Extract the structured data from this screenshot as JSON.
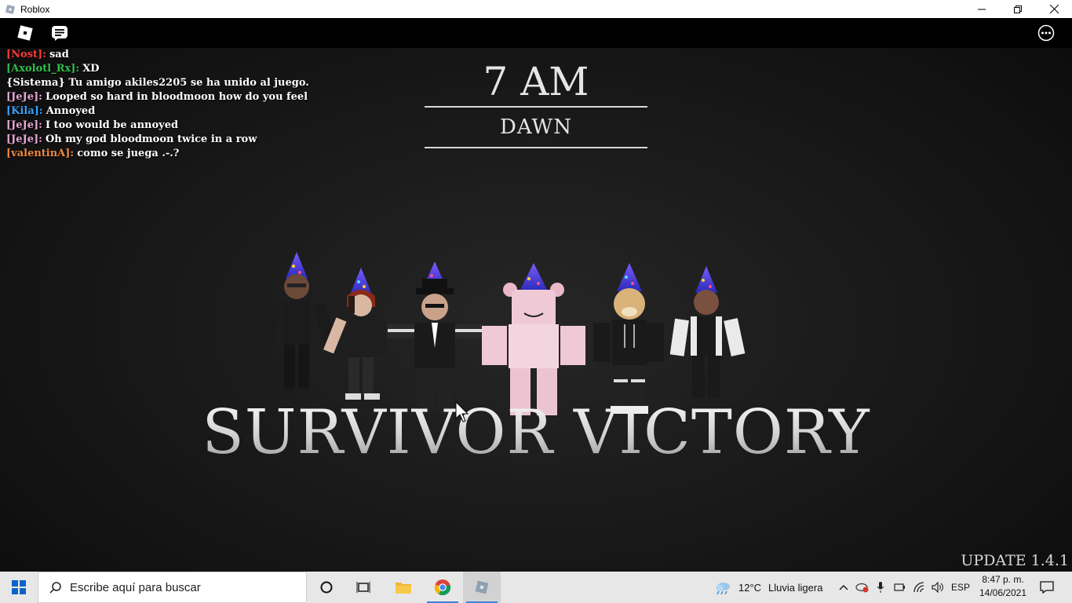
{
  "window": {
    "title": "Roblox"
  },
  "chat": [
    {
      "name": "[Nost]:",
      "color": "#ff3b3b",
      "text": "sad"
    },
    {
      "name": "[Axolotl_Rx]:",
      "color": "#2fbf4a",
      "text": "XD"
    },
    {
      "name": "",
      "color": "#ffffff",
      "text": "{Sistema} Tu amigo akiles2205 se ha unido al juego."
    },
    {
      "name": "[JeJe]:",
      "color": "#e7a6d3",
      "text": "Looped so hard in bloodmoon how do you feel"
    },
    {
      "name": "[Kila]:",
      "color": "#36a3ff",
      "text": "Annoyed"
    },
    {
      "name": "[JeJe]:",
      "color": "#e7a6d3",
      "text": "I too would be annoyed"
    },
    {
      "name": "[JeJe]:",
      "color": "#e7a6d3",
      "text": "Oh my god bloodmoon twice in a row"
    },
    {
      "name": "[valentinA]:",
      "color": "#f0883e",
      "text": "como se juega .-.?"
    }
  ],
  "game": {
    "hour": "7 AM",
    "phase": "DAWN",
    "result": "SURVIVOR VICTORY",
    "version": "UPDATE 1.4.1"
  },
  "taskbar": {
    "search_placeholder": "Escribe aquí para buscar",
    "weather_temp": "12°C",
    "weather_desc": "Lluvia ligera",
    "language": "ESP",
    "time": "8:47 p. m.",
    "date": "14/06/2021"
  }
}
